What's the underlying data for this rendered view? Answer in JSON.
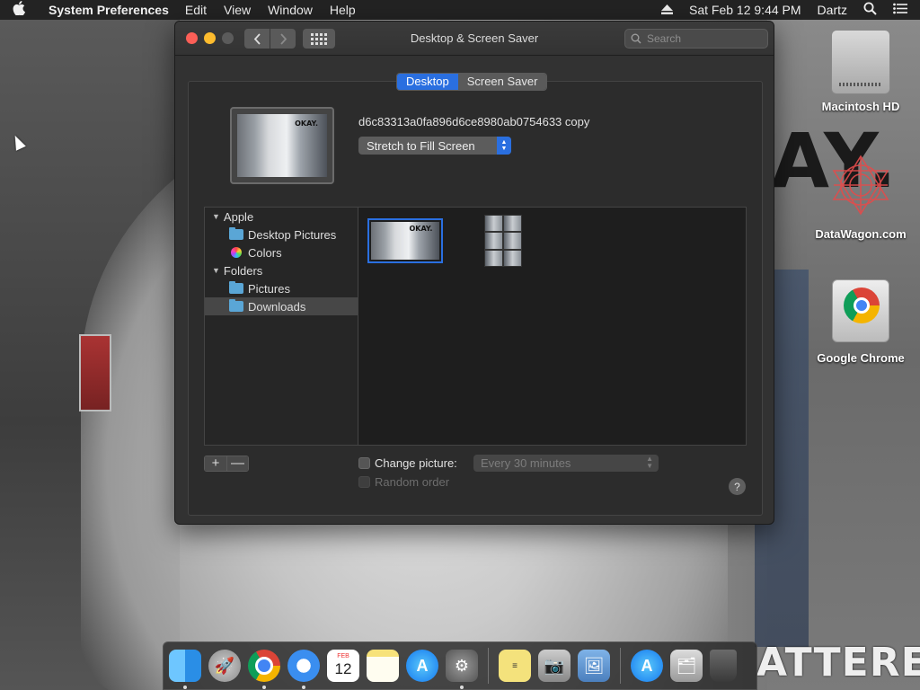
{
  "menubar": {
    "app_name": "System Preferences",
    "menus": [
      "Edit",
      "View",
      "Window",
      "Help"
    ],
    "datetime": "Sat Feb 12  9:44 PM",
    "user": "Dartz"
  },
  "window": {
    "title": "Desktop & Screen Saver",
    "search_placeholder": "Search",
    "tabs": [
      {
        "label": "Desktop",
        "active": true
      },
      {
        "label": "Screen Saver",
        "active": false
      }
    ],
    "current_file": "d6c83313a0fa896d6ce8980ab0754633 copy",
    "fill_mode": "Stretch to Fill Screen",
    "sidebar": {
      "groups": [
        {
          "label": "Apple",
          "items": [
            "Desktop Pictures",
            "Colors"
          ]
        },
        {
          "label": "Folders",
          "items": [
            "Pictures",
            "Downloads"
          ]
        }
      ],
      "selected": "Downloads"
    },
    "thumbnail_caption": "OKAY.",
    "add_label": "+",
    "remove_label": "—",
    "change_picture_label": "Change picture:",
    "change_interval": "Every 30 minutes",
    "random_order_label": "Random order",
    "help_label": "?"
  },
  "desktop_icons": [
    {
      "label": "Macintosh HD",
      "icon": "hard-drive-icon"
    },
    {
      "label": "DataWagon.com",
      "icon": "datawagon-icon"
    },
    {
      "label": "Google Chrome",
      "icon": "chrome-icon"
    }
  ],
  "wallpaper_text": {
    "big": "AY.",
    "bottom": "ATTEREDS"
  },
  "dock": {
    "calendar_month": "FEB",
    "calendar_day": "12",
    "app_store_glyph": "A",
    "stickies_glyph": "≡"
  }
}
